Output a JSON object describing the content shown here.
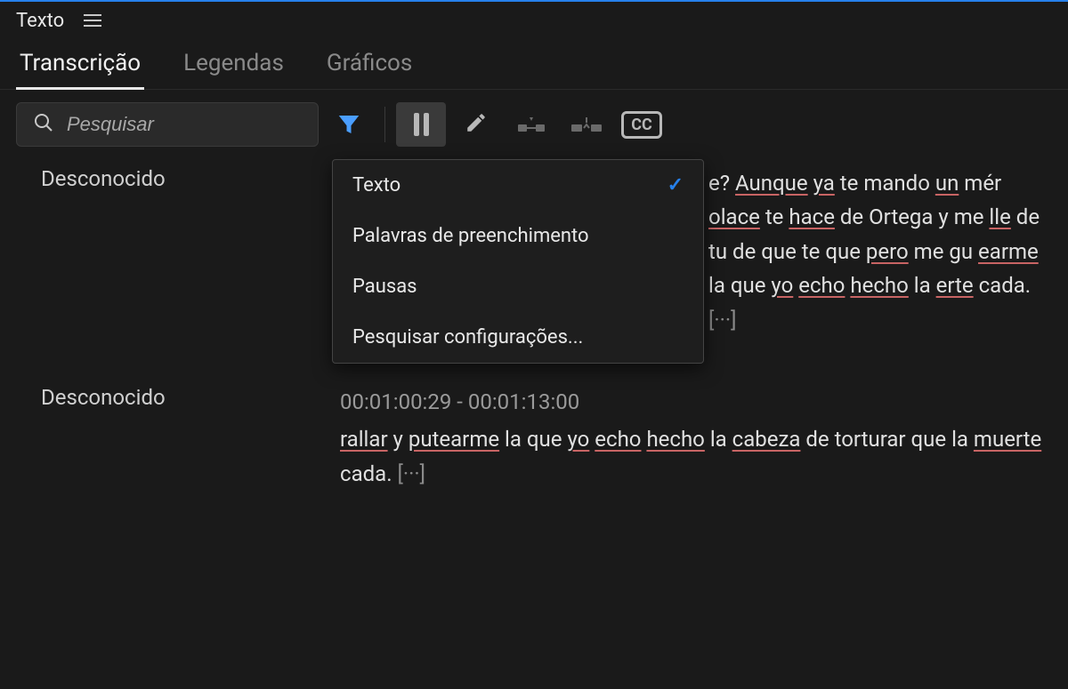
{
  "panel": {
    "title": "Texto"
  },
  "tabs": [
    {
      "label": "Transcrição",
      "active": true
    },
    {
      "label": "Legendas",
      "active": false
    },
    {
      "label": "Gráficos",
      "active": false
    }
  ],
  "search": {
    "placeholder": "Pesquisar"
  },
  "dropdown": {
    "items": [
      {
        "label": "Texto",
        "checked": true
      },
      {
        "label": "Palavras de preenchimento",
        "checked": false
      },
      {
        "label": "Pausas",
        "checked": false
      },
      {
        "label": "Pesquisar configurações...",
        "checked": false
      }
    ]
  },
  "entries": [
    {
      "speaker": "Desconocido",
      "timecode": "",
      "fragments": [
        {
          "t": "e? ",
          "u": false
        },
        {
          "t": "Aunque",
          "u": true
        },
        {
          "t": " ",
          "u": false
        },
        {
          "t": "ya",
          "u": true
        },
        {
          "t": " te mando ",
          "u": false
        },
        {
          "t": "un",
          "u": true
        },
        {
          "t": " mér ",
          "u": false
        },
        {
          "t": "olace",
          "u": true
        },
        {
          "t": " te ",
          "u": false
        },
        {
          "t": "hace",
          "u": true
        },
        {
          "t": " de Ortega y me ",
          "u": false
        },
        {
          "t": "lle",
          "u": true
        },
        {
          "t": " de tu de que te que ",
          "u": false
        },
        {
          "t": "pero",
          "u": true
        },
        {
          "t": " me gu ",
          "u": false
        },
        {
          "t": "earme",
          "u": true
        },
        {
          "t": " la que ",
          "u": false
        },
        {
          "t": "yo",
          "u": true
        },
        {
          "t": " ",
          "u": false
        },
        {
          "t": "echo",
          "u": true
        },
        {
          "t": " ",
          "u": false
        },
        {
          "t": "hecho",
          "u": true
        },
        {
          "t": " la ",
          "u": false
        },
        {
          "t": "erte",
          "u": true
        },
        {
          "t": " cada. ",
          "u": false
        }
      ],
      "ellipsis": "[···]"
    },
    {
      "speaker": "Desconocido",
      "timecode": "00:01:00:29 - 00:01:13:00",
      "fragments": [
        {
          "t": "rallar",
          "u": true
        },
        {
          "t": " y ",
          "u": false
        },
        {
          "t": "putearme",
          "u": true
        },
        {
          "t": " la que ",
          "u": false
        },
        {
          "t": "yo",
          "u": true
        },
        {
          "t": " ",
          "u": false
        },
        {
          "t": "echo",
          "u": true
        },
        {
          "t": " ",
          "u": false
        },
        {
          "t": "hecho",
          "u": true
        },
        {
          "t": " la ",
          "u": false
        },
        {
          "t": "cabeza",
          "u": true
        },
        {
          "t": " de torturar que la ",
          "u": false
        },
        {
          "t": "muerte",
          "u": true
        },
        {
          "t": " cada. ",
          "u": false
        }
      ],
      "ellipsis": "[···]"
    }
  ]
}
